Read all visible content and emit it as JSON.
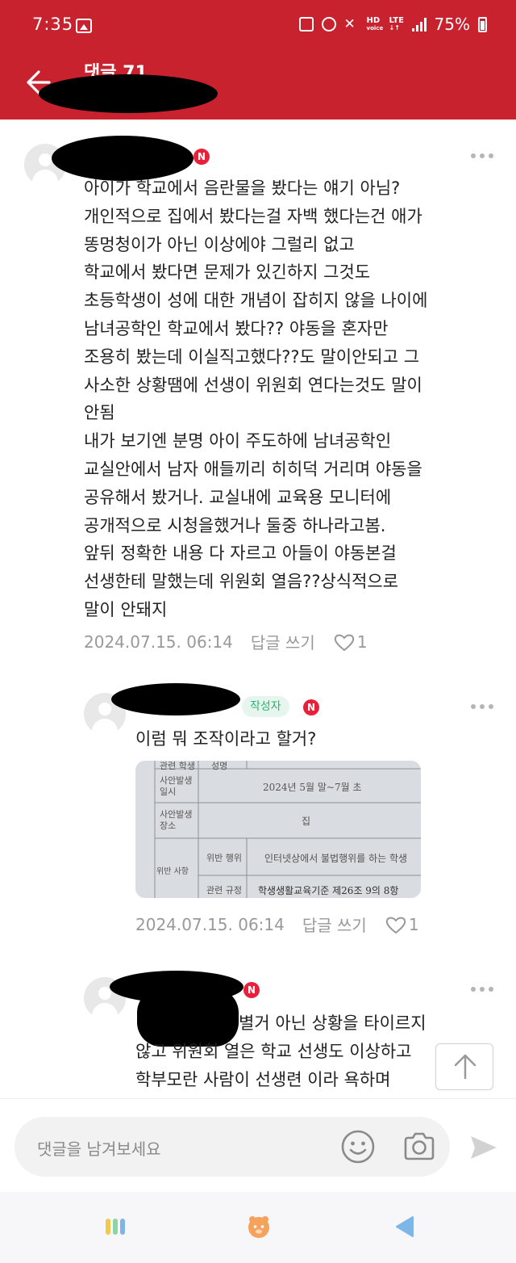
{
  "status_bar": {
    "time": "7:35",
    "hd_label": "HD",
    "voice_label": "voice",
    "lte_label": "LTE",
    "battery_percent": "75%"
  },
  "header": {
    "title": "댓글 71",
    "background_color": "#c8222f"
  },
  "comments": [
    {
      "text": "아이가 학교에서 음란물을 봤다는 얘기 아님?\n개인적으로 집에서 봤다는걸 자백 했다는건 애가\n똥멍청이가 아닌 이상에야 그럴리 없고\n학교에서 봤다면 문제가 있긴하지 그것도\n초등학생이 성에 대한 개념이 잡히지 않을 나이에\n남녀공학인 학교에서 봤다?? 야동을 혼자만\n조용히 봤는데 이실직고했다??도 말이안되고 그\n사소한 상황땜에 선생이 위원회 연다는것도 말이\n안됨\n내가 보기엔 분명 아이 주도하에 남녀공학인\n교실안에서 남자 애들끼리 히히덕 거리며 야동을\n공유해서 봤거나. 교실내에 교육용 모니터에\n공개적으로 시청을했거나 둘중 하나라고봄.\n앞뒤 정확한 내용 다 자르고 아들이 야동본걸\n선생한테 말했는데 위원회 열음??상식적으로\n말이 안돼지",
      "date": "2024.07.15. 06:14",
      "reply_label": "답글 쓰기",
      "likes": "1"
    },
    {
      "author_tag": "작성자",
      "text": "이럼 뭐 조작이라고 할거?",
      "date": "2024.07.15. 06:14",
      "reply_label": "답글 쓰기",
      "likes": "1",
      "photo": {
        "row1_label": "관련 학생",
        "row1_value": "성명",
        "row2_label": "사안발생\n일시",
        "row2_value": "2024년 5월 말~7월 초",
        "row3_label": "사안발생\n장소",
        "row3_value": "집",
        "row4_label": "위반 행위",
        "row4_value": "인터넷상에서 불법행위를 하는 학생",
        "row5_label": "관련 규정",
        "row5_value": "학생생활교육기준 제26조 9의 8항",
        "side_label": "위반 사항"
      }
    },
    {
      "text": "별거 아닌 상황을 타이르지\n않고 위원회 열은 학교 선생도 이상하고\n학부모란 사람이 선생련 이라 욕하며"
    }
  ],
  "badge_n": "N",
  "input": {
    "placeholder": "댓글을 남겨보세요"
  },
  "icons": {
    "back": "arrow-left-icon",
    "more": "more-horizontal-icon",
    "heart": "heart-outline-icon",
    "emoji": "smiley-icon",
    "camera": "camera-icon",
    "send": "send-icon",
    "scroll_top": "arrow-up-icon"
  },
  "colors": {
    "accent": "#c8222f",
    "badge": "#e9203a",
    "author_tag_text": "#2bb673",
    "author_tag_bg": "#e6f6ee",
    "meta_text": "#999999"
  }
}
